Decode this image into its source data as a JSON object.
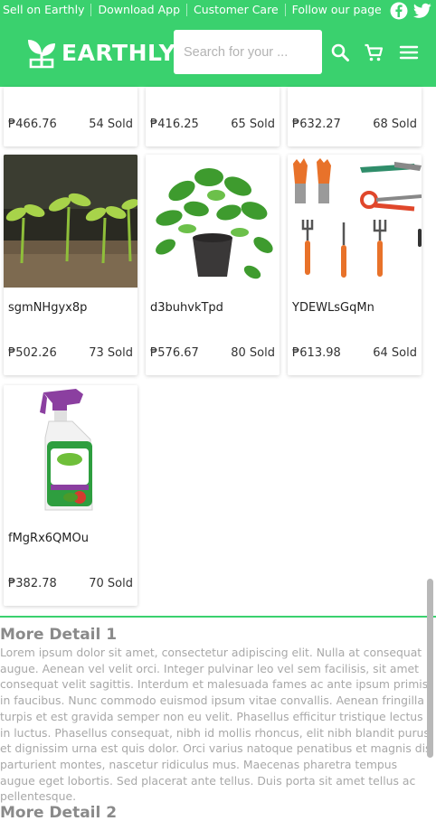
{
  "topbar": {
    "links": [
      "Sell on Earthly",
      "Download App",
      "Customer Care",
      "Follow our page"
    ],
    "social": [
      "facebook-icon",
      "twitter-icon"
    ]
  },
  "header": {
    "logo_text": "EARTHLY",
    "search_placeholder": "Search for your ...",
    "icons": [
      "search-icon",
      "cart-icon",
      "menu-icon"
    ]
  },
  "products": [
    {
      "name": "",
      "price": "₱466.76",
      "sold": "54 Sold"
    },
    {
      "name": "",
      "price": "₱416.25",
      "sold": "65 Sold"
    },
    {
      "name": "",
      "price": "₱632.27",
      "sold": "68 Sold"
    },
    {
      "name": "sgmNHgyx8p",
      "price": "₱502.26",
      "sold": "73 Sold",
      "image": "seedlings"
    },
    {
      "name": "d3buhvkTpd",
      "price": "₱576.67",
      "sold": "80 Sold",
      "image": "potted-plant"
    },
    {
      "name": "YDEWLsGqMn",
      "price": "₱613.98",
      "sold": "64 Sold",
      "image": "garden-tools"
    },
    {
      "name": "fMgRx6QMOu",
      "price": "₱382.78",
      "sold": "70 Sold",
      "image": "spray-bottle"
    }
  ],
  "details": [
    {
      "title": "More Detail 1",
      "body": "Lorem ipsum dolor sit amet, consectetur adipiscing elit. Nulla at consequat augue. Aenean vel velit orci. Integer pulvinar leo vel sem facilisis, sit amet consequat velit sagittis. Interdum et malesuada fames ac ante ipsum primis in faucibus. Nunc commodo euismod ipsum vitae convallis. Aenean fringilla turpis et est gravida semper non eu velit. Phasellus efficitur tristique lectus in luctus. Phasellus consequat, nibh id mollis rhoncus, elit nibh blandit purus, et dignissim urna est quis dolor. Orci varius natoque penatibus et magnis dis parturient montes, nascetur ridiculus mus. Maecenas pharetra tempus augue eget lobortis. Sed placerat ante tellus. Duis porta sit amet tellus ac pellentesque."
    },
    {
      "title": "More Detail 2"
    }
  ],
  "colors": {
    "brand": "#3ad16e",
    "muted_text": "#a8a8a8"
  }
}
